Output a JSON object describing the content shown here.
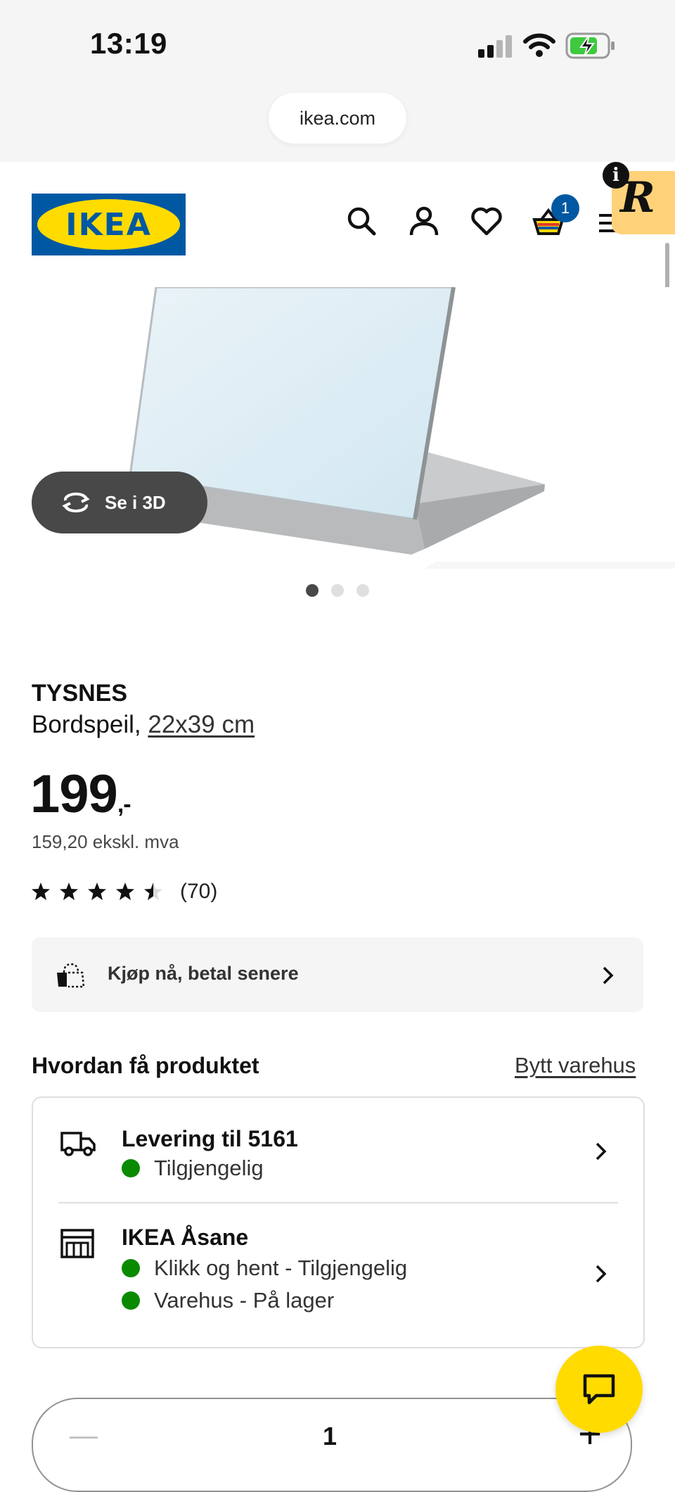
{
  "status_bar": {
    "time": "13:19",
    "url": "ikea.com"
  },
  "header": {
    "logo_text": "IKEA",
    "cart_count": "1",
    "extension_info": "i",
    "extension_letter": "R",
    "icons": [
      "search-icon",
      "user-icon",
      "heart-icon",
      "cart-icon",
      "menu-icon"
    ]
  },
  "gallery": {
    "view_3d_label": "Se i 3D",
    "active_image": 1,
    "image_count": 3
  },
  "product": {
    "name": "TYSNES",
    "description": "Bordspeil, ",
    "size": "22x39 cm",
    "price": "199",
    "price_suffix": ",-",
    "price_ex_vat": "159,20 ekskl. mva",
    "rating": 4.5,
    "rating_max": 5,
    "review_count": "(70)"
  },
  "pay_later": {
    "label": "Kjøp nå, betal senere"
  },
  "availability": {
    "title": "Hvordan få produktet",
    "change_store": "Bytt varehus",
    "delivery": {
      "title": "Levering til 5161",
      "status": "Tilgjengelig"
    },
    "store": {
      "title": "IKEA Åsane",
      "click_collect": "Klikk og hent - Tilgjengelig",
      "in_store": "Varehus - På lager"
    }
  },
  "quantity": {
    "value": "1",
    "minus": "—",
    "plus": "+"
  },
  "colors": {
    "ikea_blue": "#0058a3",
    "ikea_yellow": "#ffdb00",
    "available_green": "#0a8a00"
  }
}
